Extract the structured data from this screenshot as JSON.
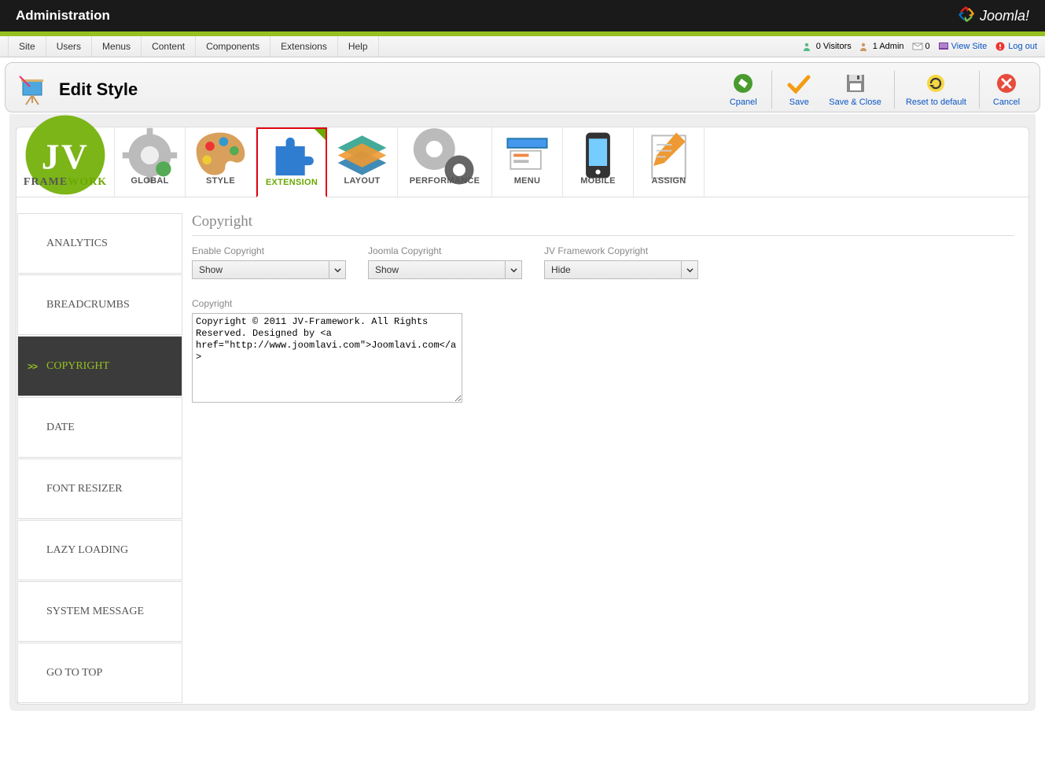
{
  "header": {
    "title": "Administration",
    "brand": "Joomla!"
  },
  "menubar": {
    "items": [
      "Site",
      "Users",
      "Menus",
      "Content",
      "Components",
      "Extensions",
      "Help"
    ],
    "status": {
      "visitors": "0 Visitors",
      "admin": "1 Admin",
      "messages": "0",
      "view_site": "View Site",
      "logout": "Log out"
    }
  },
  "page": {
    "title": "Edit Style"
  },
  "toolbar": {
    "cpanel": "Cpanel",
    "save": "Save",
    "save_close": "Save & Close",
    "reset": "Reset to default",
    "cancel": "Cancel"
  },
  "tabs": {
    "framework_prefix": "FRAME",
    "framework_suffix": "WORK",
    "items": [
      "GLOBAL",
      "STYLE",
      "EXTENSION",
      "LAYOUT",
      "PERFORMANCE",
      "MENU",
      "MOBILE",
      "ASSIGN"
    ],
    "active_index": 2
  },
  "sidebar": {
    "items": [
      "ANALYTICS",
      "BREADCRUMBS",
      "COPYRIGHT",
      "DATE",
      "FONT RESIZER",
      "LAZY LOADING",
      "SYSTEM MESSAGE",
      "GO TO TOP"
    ],
    "active_index": 2
  },
  "form": {
    "section_title": "Copyright",
    "enable_label": "Enable Copyright",
    "enable_value": "Show",
    "joomla_label": "Joomla Copyright",
    "joomla_value": "Show",
    "jv_label": "JV Framework Copyright",
    "jv_value": "Hide",
    "copyright_label": "Copyright",
    "copyright_value": "Copyright © 2011 JV-Framework. All Rights Reserved. Designed by <a href=\"http://www.joomlavi.com\">Joomlavi.com</a>"
  }
}
